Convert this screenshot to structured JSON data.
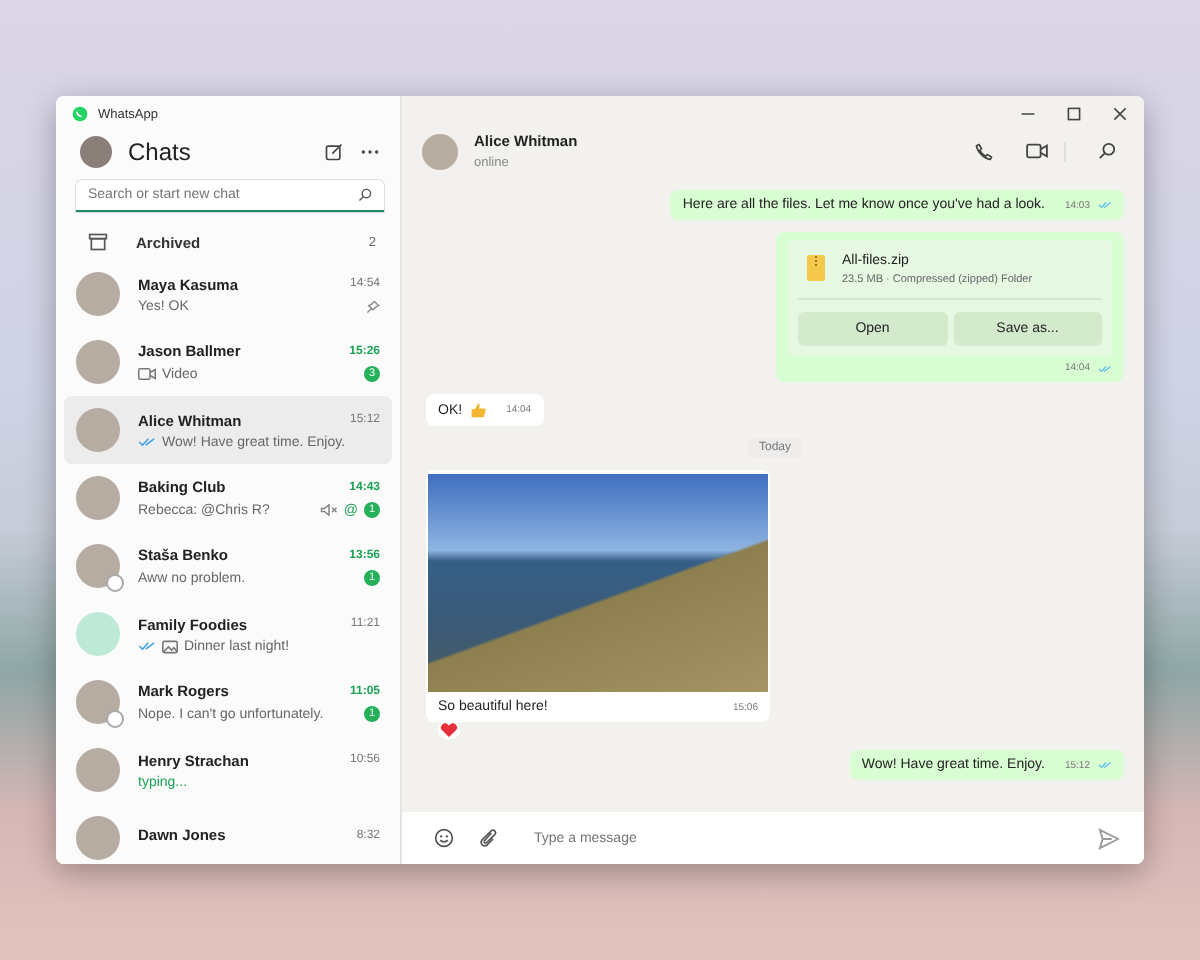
{
  "window": {
    "title": "WhatsApp"
  },
  "sidebar": {
    "title": "Chats",
    "search": {
      "placeholder": "Search or start new chat"
    },
    "archived": {
      "label": "Archived",
      "count": "2"
    },
    "chats": [
      {
        "name": "Maya Kasuma",
        "time": "14:54",
        "preview": "Yes! OK",
        "selected": false,
        "highlight_time": false,
        "pinned": true
      },
      {
        "name": "Jason Ballmer",
        "time": "15:26",
        "preview": "Video",
        "video": true,
        "selected": false,
        "highlight_time": true,
        "unread": "3"
      },
      {
        "name": "Alice Whitman",
        "time": "15:12",
        "preview": "Wow! Have great time. Enjoy.",
        "ticks": true,
        "selected": true,
        "highlight_time": false
      },
      {
        "name": "Baking Club",
        "time": "14:43",
        "preview": "Rebecca: @Chris R?",
        "selected": false,
        "highlight_time": true,
        "muted": true,
        "mention": "@",
        "unread": "1"
      },
      {
        "name": "Staša Benko",
        "time": "13:56",
        "preview": "Aww no problem.",
        "selected": false,
        "highlight_time": true,
        "status": true,
        "unread": "1"
      },
      {
        "name": "Family Foodies",
        "time": "11:21",
        "preview": "Dinner last night!",
        "photo": true,
        "ticks": true,
        "selected": false,
        "highlight_time": false,
        "group": true
      },
      {
        "name": "Mark Rogers",
        "time": "11:05",
        "preview": "Nope. I can't go unfortunately.",
        "selected": false,
        "highlight_time": true,
        "status": true,
        "unread": "1"
      },
      {
        "name": "Henry Strachan",
        "time": "10:56",
        "preview": "typing...",
        "typing": true,
        "selected": false,
        "highlight_time": false
      },
      {
        "name": "Dawn Jones",
        "time": "8:32",
        "selected": false,
        "highlight_time": false
      }
    ]
  },
  "chat": {
    "name": "Alice Whitman",
    "status": "online",
    "messages": [
      {
        "kind": "text",
        "outgoing": true,
        "text": "Here are all the files. Let me know once you've had a look.",
        "time": "14:03"
      },
      {
        "kind": "file",
        "outgoing": true,
        "file_name": "All-files.zip",
        "file_info": "23.5 MB · Compressed (zipped) Folder",
        "buttons": [
          "Open",
          "Save as..."
        ],
        "time": "14:04"
      },
      {
        "kind": "text",
        "outgoing": false,
        "text": "OK!",
        "thumbs_up": true,
        "time": "14:04"
      },
      {
        "kind": "date",
        "text": "Today"
      },
      {
        "kind": "photo",
        "outgoing": false,
        "caption": "So beautiful here!",
        "time": "15:06",
        "hearted": true
      },
      {
        "kind": "text",
        "outgoing": true,
        "text": "Wow! Have great time. Enjoy.",
        "time": "15:12"
      }
    ],
    "composer": {
      "placeholder": "Type a message"
    }
  }
}
